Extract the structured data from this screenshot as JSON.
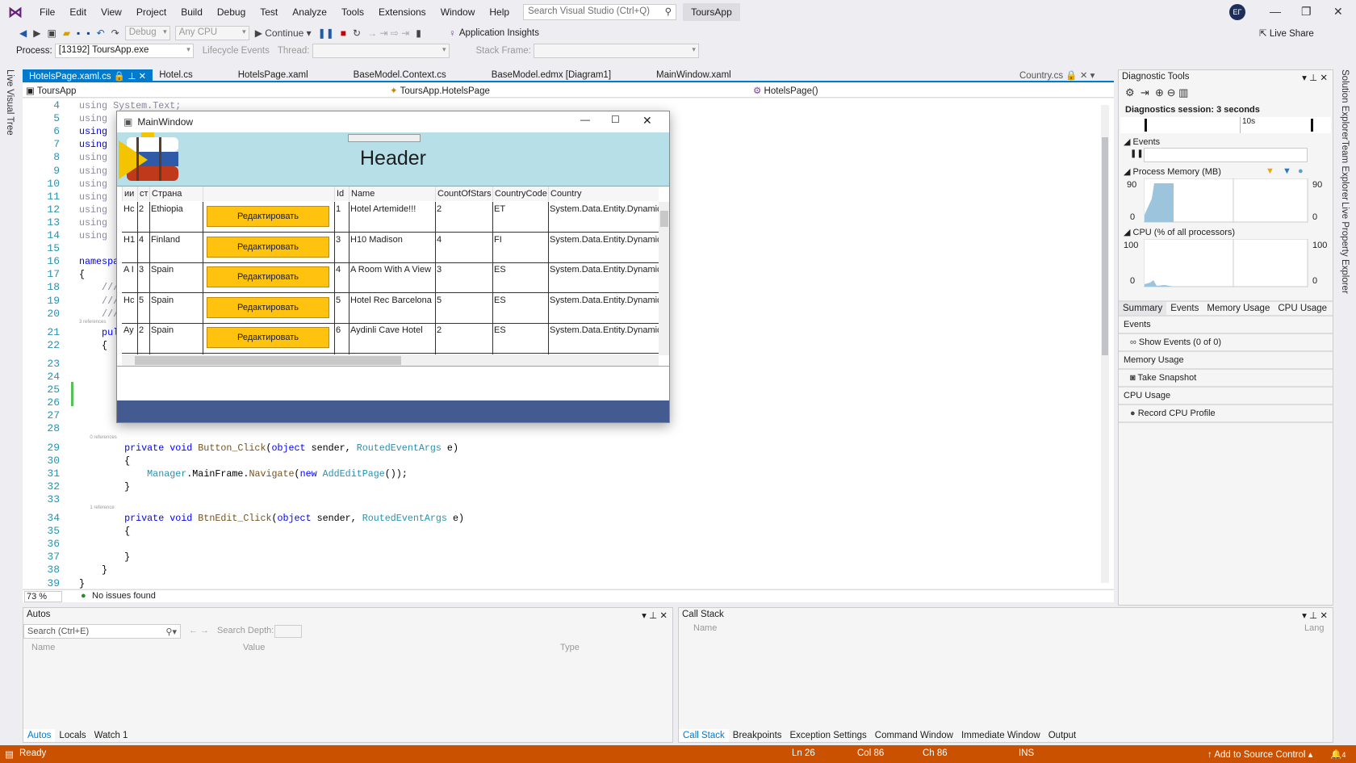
{
  "menu": {
    "items": [
      "File",
      "Edit",
      "View",
      "Project",
      "Build",
      "Debug",
      "Test",
      "Analyze",
      "Tools",
      "Extensions",
      "Window",
      "Help"
    ],
    "search_placeholder": "Search Visual Studio (Ctrl+Q)",
    "solution": "ToursApp",
    "avatar": "ЕГ"
  },
  "toolbar": {
    "config": "Debug",
    "platform": "Any CPU",
    "continue": "Continue",
    "app_insights": "Application Insights",
    "live_share": "Live Share"
  },
  "toolbar2": {
    "process_label": "Process:",
    "process": "[13192] ToursApp.exe",
    "lifecycle": "Lifecycle Events",
    "thread_label": "Thread:",
    "stack_frame_label": "Stack Frame:"
  },
  "left_rail": "Live Visual Tree",
  "right_rail": [
    "Solution Explorer",
    "Team Explorer",
    "Live Property Explorer"
  ],
  "tabs": [
    {
      "label": "HotelsPage.xaml.cs",
      "active": true
    },
    {
      "label": "Hotel.cs"
    },
    {
      "label": "HotelsPage.xaml"
    },
    {
      "label": "BaseModel.Context.cs"
    },
    {
      "label": "BaseModel.edmx [Diagram1]"
    },
    {
      "label": "MainWindow.xaml"
    }
  ],
  "tab_right": "Country.cs",
  "navbar": {
    "project": "ToursApp",
    "type": "ToursApp.HotelsPage",
    "member": "HotelsPage()"
  },
  "code": {
    "lines": [
      {
        "n": "4",
        "tokens": [
          [
            "using ",
            "d"
          ],
          [
            "System.Text;",
            "d"
          ]
        ]
      },
      {
        "n": "5",
        "tokens": [
          [
            "using",
            "d"
          ]
        ]
      },
      {
        "n": "6",
        "tokens": [
          [
            "using",
            "k"
          ]
        ]
      },
      {
        "n": "7",
        "tokens": [
          [
            "using",
            "k"
          ]
        ]
      },
      {
        "n": "8",
        "tokens": [
          [
            "using",
            "d"
          ]
        ]
      },
      {
        "n": "9",
        "tokens": [
          [
            "using",
            "d"
          ]
        ]
      },
      {
        "n": "10",
        "tokens": [
          [
            "using",
            "d"
          ]
        ]
      },
      {
        "n": "11",
        "tokens": [
          [
            "using",
            "d"
          ]
        ]
      },
      {
        "n": "12",
        "tokens": [
          [
            "using",
            "d"
          ]
        ]
      },
      {
        "n": "13",
        "tokens": [
          [
            "using",
            "d"
          ]
        ]
      },
      {
        "n": "14",
        "tokens": [
          [
            "using",
            "d"
          ]
        ]
      },
      {
        "n": "15",
        "tokens": []
      },
      {
        "n": "16",
        "tokens": [
          [
            "namespa",
            "k"
          ]
        ]
      },
      {
        "n": "17",
        "tokens": [
          [
            "{",
            ""
          ]
        ]
      },
      {
        "n": "18",
        "tokens": [
          [
            "    ///",
            "d"
          ]
        ]
      },
      {
        "n": "19",
        "tokens": [
          [
            "    ///",
            "d"
          ]
        ]
      },
      {
        "n": "20",
        "tokens": [
          [
            "    ///",
            "d"
          ]
        ]
      },
      {
        "lens": "3 references"
      },
      {
        "n": "21",
        "tokens": [
          [
            "    pul",
            "k"
          ]
        ]
      },
      {
        "n": "22",
        "tokens": [
          [
            "    {",
            ""
          ]
        ]
      },
      {
        "lens": ""
      },
      {
        "n": "23",
        "tokens": []
      },
      {
        "n": "24",
        "tokens": []
      },
      {
        "n": "25",
        "tokens": []
      },
      {
        "n": "26",
        "tokens": []
      },
      {
        "n": "27",
        "tokens": []
      },
      {
        "n": "28",
        "tokens": []
      },
      {
        "lens": "        0 references"
      },
      {
        "n": "29",
        "tokens": [
          [
            "        private void ",
            "k"
          ],
          [
            "Button_Click",
            "m"
          ],
          [
            "(",
            ""
          ],
          [
            "object",
            "k"
          ],
          [
            " sender, ",
            ""
          ],
          [
            "RoutedEventArgs",
            "t"
          ],
          [
            " e)",
            ""
          ]
        ]
      },
      {
        "n": "30",
        "tokens": [
          [
            "        {",
            ""
          ]
        ]
      },
      {
        "n": "31",
        "tokens": [
          [
            "            ",
            ""
          ],
          [
            "Manager",
            "t"
          ],
          [
            ".MainFrame.",
            ""
          ],
          [
            "Navigate",
            "m"
          ],
          [
            "(",
            ""
          ],
          [
            "new ",
            "k"
          ],
          [
            "AddEditPage",
            "t"
          ],
          [
            "());",
            ""
          ]
        ]
      },
      {
        "n": "32",
        "tokens": [
          [
            "        }",
            ""
          ]
        ]
      },
      {
        "n": "33",
        "tokens": []
      },
      {
        "lens": "        1 reference"
      },
      {
        "n": "34",
        "tokens": [
          [
            "        private void ",
            "k"
          ],
          [
            "BtnEdit_Click",
            "m"
          ],
          [
            "(",
            ""
          ],
          [
            "object",
            "k"
          ],
          [
            " sender, ",
            ""
          ],
          [
            "RoutedEventArgs",
            "t"
          ],
          [
            " e)",
            ""
          ]
        ]
      },
      {
        "n": "35",
        "tokens": [
          [
            "        {",
            ""
          ]
        ]
      },
      {
        "n": "36",
        "tokens": []
      },
      {
        "n": "37",
        "tokens": [
          [
            "        }",
            ""
          ]
        ]
      },
      {
        "n": "38",
        "tokens": [
          [
            "    }",
            ""
          ]
        ]
      },
      {
        "n": "39",
        "tokens": [
          [
            "}",
            ""
          ]
        ]
      }
    ]
  },
  "editor_status": {
    "zoom": "73 %",
    "issues": "No issues found"
  },
  "main_window": {
    "title": "MainWindow",
    "header": "Header",
    "columns": [
      "ии",
      "ст",
      "Страна",
      "",
      "Id",
      "Name",
      "CountOfStars",
      "CountryCode",
      "Country"
    ],
    "edit_label": "Редактировать",
    "rows": [
      [
        "Hc",
        "2",
        "Ethiopia",
        "1",
        "Hotel Artemide!!!",
        "2",
        "ET",
        "System.Data.Entity.DynamicP"
      ],
      [
        "H1",
        "4",
        "Finland",
        "3",
        "H10 Madison",
        "4",
        "FI",
        "System.Data.Entity.DynamicP"
      ],
      [
        "A I",
        "3",
        "Spain",
        "4",
        "A Room With A View",
        "3",
        "ES",
        "System.Data.Entity.DynamicP"
      ],
      [
        "Hc",
        "5",
        "Spain",
        "5",
        "Hotel Rec Barcelona",
        "5",
        "ES",
        "System.Data.Entity.DynamicP"
      ],
      [
        "Ay",
        "2",
        "Spain",
        "6",
        "Aydinli Cave Hotel",
        "2",
        "ES",
        "System.Data.Entity.DynamicP"
      ]
    ],
    "colors": {
      "header_bg": "#b7dfe8",
      "button": "#ffc20e",
      "footer": "#445b92"
    }
  },
  "diagnostics": {
    "title": "Diagnostic Tools",
    "session": "Diagnostics session: 3 seconds",
    "timeline_tick": "10s",
    "events_label": "Events",
    "memory_label": "Process Memory (MB)",
    "mem_max": "90",
    "mem_min": "0",
    "cpu_label": "CPU (% of all processors)",
    "cpu_max": "100",
    "cpu_min": "0",
    "tabs": [
      "Summary",
      "Events",
      "Memory Usage",
      "CPU Usage"
    ],
    "sections": [
      {
        "title": "Events",
        "action": "Show Events (0 of 0)"
      },
      {
        "title": "Memory Usage",
        "action": "Take Snapshot"
      },
      {
        "title": "CPU Usage",
        "action": "Record CPU Profile"
      }
    ]
  },
  "autos": {
    "title": "Autos",
    "search_placeholder": "Search (Ctrl+E)",
    "depth_label": "Search Depth:",
    "columns": [
      "Name",
      "Value",
      "Type"
    ],
    "tabs": [
      "Autos",
      "Locals",
      "Watch 1"
    ]
  },
  "callstack": {
    "title": "Call Stack",
    "columns": [
      "Name",
      "Lang"
    ],
    "tabs": [
      "Call Stack",
      "Breakpoints",
      "Exception Settings",
      "Command Window",
      "Immediate Window",
      "Output"
    ]
  },
  "statusbar": {
    "ready": "Ready",
    "ln": "Ln 26",
    "col": "Col 86",
    "ch": "Ch 86",
    "ins": "INS",
    "source_control": "Add to Source Control",
    "notifications": "4",
    "accent": "#ca5100"
  }
}
